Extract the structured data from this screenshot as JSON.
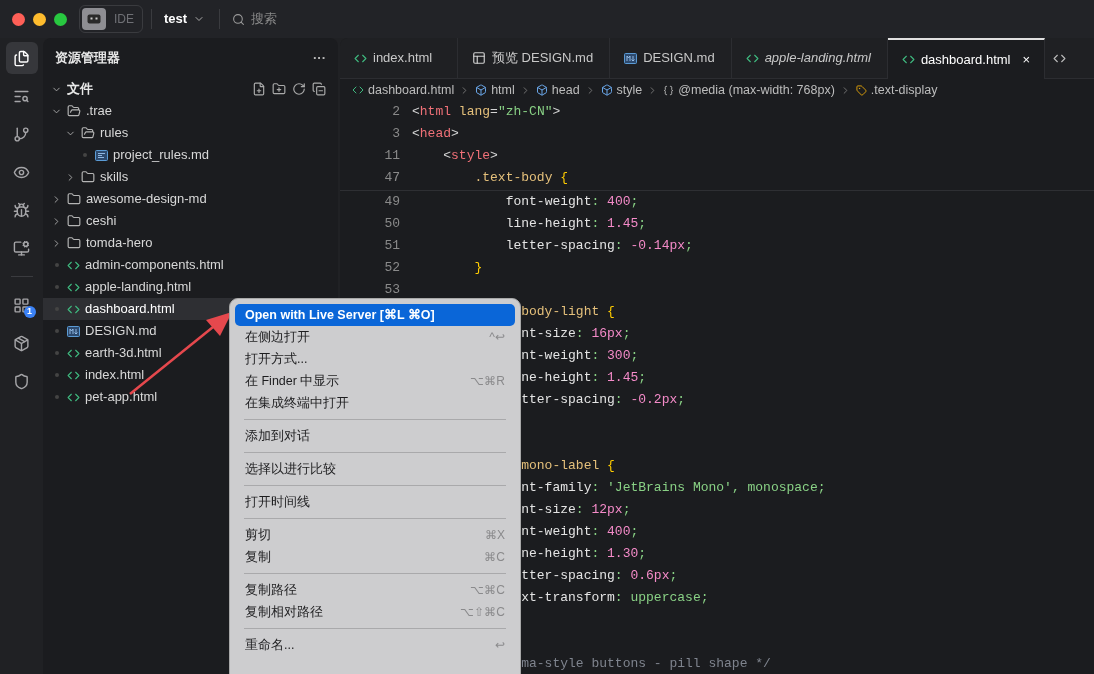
{
  "titlebar": {
    "modes": [
      {
        "kind": "icon",
        "selected": true
      },
      {
        "kind": "text",
        "label": "IDE",
        "selected": false
      }
    ],
    "project": "test",
    "search_placeholder": "搜索"
  },
  "activity_bar": [
    {
      "selected": true
    },
    {
      "selected": false
    },
    {
      "selected": false
    },
    {
      "selected": false
    },
    {
      "selected": false
    },
    {
      "selected": false
    },
    {
      "selected": false,
      "badge": "1"
    },
    {
      "selected": false
    },
    {
      "selected": false
    }
  ],
  "sidebar": {
    "title": "资源管理器",
    "more": "···",
    "section": "文件",
    "section_expanded": true,
    "items": [
      {
        "name": ".trae",
        "kind": "folder",
        "expanded": true,
        "selected": false,
        "children": [
          {
            "name": "rules",
            "kind": "folder",
            "expanded": true,
            "selected": false,
            "children": [
              {
                "name": "project_rules.md",
                "kind": "rules",
                "selected": false
              }
            ]
          },
          {
            "name": "skills",
            "kind": "folder",
            "expanded": false,
            "selected": false
          }
        ]
      },
      {
        "name": "awesome-design-md",
        "kind": "folder",
        "expanded": false,
        "selected": false
      },
      {
        "name": "ceshi",
        "kind": "folder",
        "expanded": false,
        "selected": false
      },
      {
        "name": "tomda-hero",
        "kind": "folder",
        "expanded": false,
        "selected": false
      },
      {
        "name": "admin-components.html",
        "kind": "html",
        "selected": false
      },
      {
        "name": "apple-landing.html",
        "kind": "html",
        "selected": false
      },
      {
        "name": "dashboard.html",
        "kind": "html",
        "selected": true
      },
      {
        "name": "DESIGN.md",
        "kind": "markdown",
        "selected": false
      },
      {
        "name": "earth-3d.html",
        "kind": "html",
        "selected": false
      },
      {
        "name": "index.html",
        "kind": "html",
        "selected": false
      },
      {
        "name": "pet-app.html",
        "kind": "html",
        "selected": false
      }
    ]
  },
  "tabs": [
    {
      "label": "index.html",
      "kind": "html",
      "selected": false,
      "preview": false
    },
    {
      "label": "预览 DESIGN.md",
      "kind": "preview",
      "selected": false,
      "preview": false
    },
    {
      "label": "DESIGN.md",
      "kind": "markdown",
      "selected": false,
      "preview": false
    },
    {
      "label": "apple-landing.html",
      "kind": "html",
      "selected": false,
      "preview": true
    },
    {
      "label": "dashboard.html",
      "kind": "html",
      "selected": true,
      "preview": false,
      "close": "×"
    }
  ],
  "breadcrumb": [
    {
      "label": "dashboard.html",
      "kind": "html"
    },
    {
      "label": "html",
      "kind": "element"
    },
    {
      "label": "head",
      "kind": "element"
    },
    {
      "label": "style",
      "kind": "element"
    },
    {
      "label": "@media (max-width: 768px)",
      "kind": "braces"
    },
    {
      "label": ".text-display",
      "kind": "selector"
    }
  ],
  "sticky_lines": [
    {
      "kind": "code",
      "number": "2",
      "text": "<html lang=\"zh-CN\">"
    },
    {
      "kind": "code",
      "number": "3",
      "text": "<head>"
    },
    {
      "kind": "code",
      "number": "11",
      "text": "    <style>"
    },
    {
      "kind": "code",
      "number": "47",
      "text": "        .text-body {"
    }
  ],
  "code_lines": [
    {
      "kind": "code",
      "number": "49",
      "text": "            font-weight: 400;"
    },
    {
      "kind": "code",
      "number": "50",
      "text": "            line-height: 1.45;"
    },
    {
      "kind": "code",
      "number": "51",
      "text": "            letter-spacing: -0.14px;"
    },
    {
      "kind": "code",
      "number": "52",
      "text": "        }"
    },
    {
      "kind": "blank",
      "number": "53"
    },
    {
      "kind": "code",
      "text": "              body-light {"
    },
    {
      "kind": "code",
      "text": "              nt-size: 16px;"
    },
    {
      "kind": "code",
      "text": "              nt-weight: 300;"
    },
    {
      "kind": "code",
      "text": "              ne-height: 1.45;"
    },
    {
      "kind": "code",
      "text": "              tter-spacing: -0.2px;"
    },
    {
      "kind": "blank"
    },
    {
      "kind": "blank"
    },
    {
      "kind": "code",
      "text": "              mono-label {"
    },
    {
      "kind": "code",
      "text": "              nt-family: 'JetBrains Mono', monospace;"
    },
    {
      "kind": "code",
      "text": "              nt-size: 12px;"
    },
    {
      "kind": "code",
      "text": "              nt-weight: 400;"
    },
    {
      "kind": "code",
      "text": "              ne-height: 1.30;"
    },
    {
      "kind": "code",
      "text": "              tter-spacing: 0.6px;"
    },
    {
      "kind": "code",
      "text": "              xt-transform: uppercase;"
    },
    {
      "kind": "blank"
    },
    {
      "kind": "blank"
    },
    {
      "kind": "code",
      "text": "              ma-style buttons - pill shape */"
    }
  ],
  "context_menu": [
    {
      "kind": "item",
      "label": "Open with Live Server [⌘L ⌘O]",
      "selected": true
    },
    {
      "kind": "item",
      "label": "在侧边打开",
      "shortcut": "^↩",
      "selected": false
    },
    {
      "kind": "item",
      "label": "打开方式...",
      "selected": false
    },
    {
      "kind": "item",
      "label": "在 Finder 中显示",
      "shortcut": "⌥⌘R",
      "selected": false
    },
    {
      "kind": "item",
      "label": "在集成终端中打开",
      "selected": false
    },
    {
      "kind": "separator"
    },
    {
      "kind": "item",
      "label": "添加到对话",
      "selected": false
    },
    {
      "kind": "separator"
    },
    {
      "kind": "item",
      "label": "选择以进行比较",
      "selected": false
    },
    {
      "kind": "separator"
    },
    {
      "kind": "item",
      "label": "打开时间线",
      "selected": false
    },
    {
      "kind": "separator"
    },
    {
      "kind": "item",
      "label": "剪切",
      "shortcut": "⌘X",
      "selected": false
    },
    {
      "kind": "item",
      "label": "复制",
      "shortcut": "⌘C",
      "selected": false
    },
    {
      "kind": "separator"
    },
    {
      "kind": "item",
      "label": "复制路径",
      "shortcut": "⌥⌘C",
      "selected": false
    },
    {
      "kind": "item",
      "label": "复制相对路径",
      "shortcut": "⌥⇧⌘C",
      "selected": false
    },
    {
      "kind": "separator"
    },
    {
      "kind": "item",
      "label": "重命名...",
      "shortcut": "↩",
      "selected": false
    }
  ]
}
